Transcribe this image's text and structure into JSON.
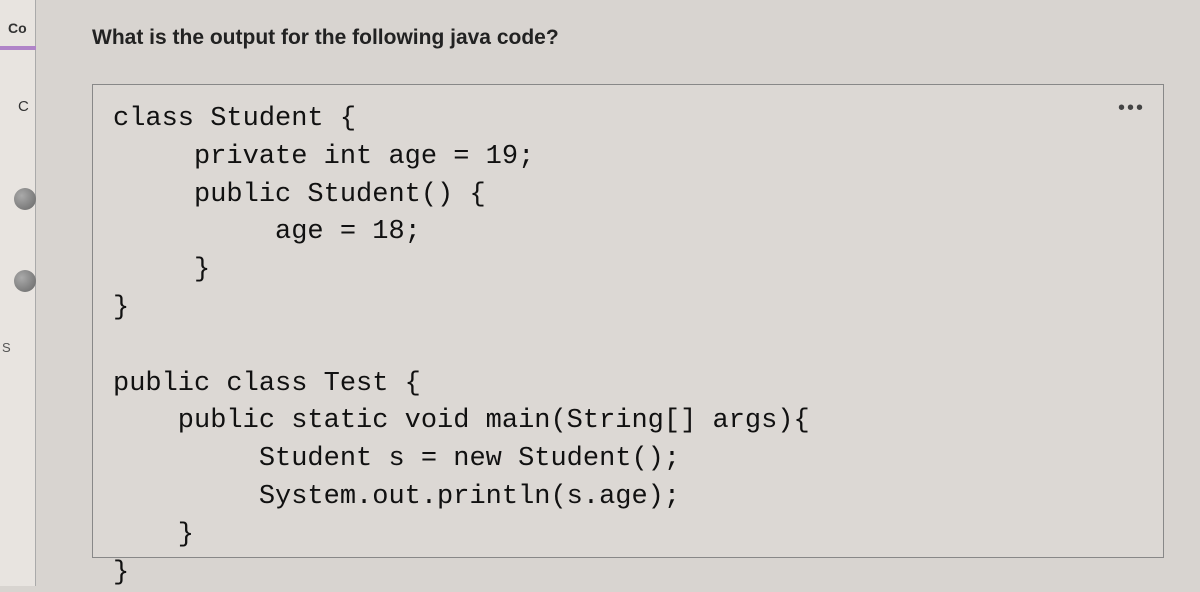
{
  "leftEdge": {
    "topLabel": "Co",
    "letterC": "C",
    "letterS": "S"
  },
  "question": {
    "title": "What is the output for the following java code?"
  },
  "code": {
    "lines": [
      "class Student {",
      "     private int age = 19;",
      "     public Student() {",
      "          age = 18;",
      "     }",
      "}",
      "",
      "public class Test {",
      "    public static void main(String[] args){",
      "         Student s = new Student();",
      "         System.out.println(s.age);",
      "    }",
      "}"
    ]
  },
  "moreIcon": "•••"
}
